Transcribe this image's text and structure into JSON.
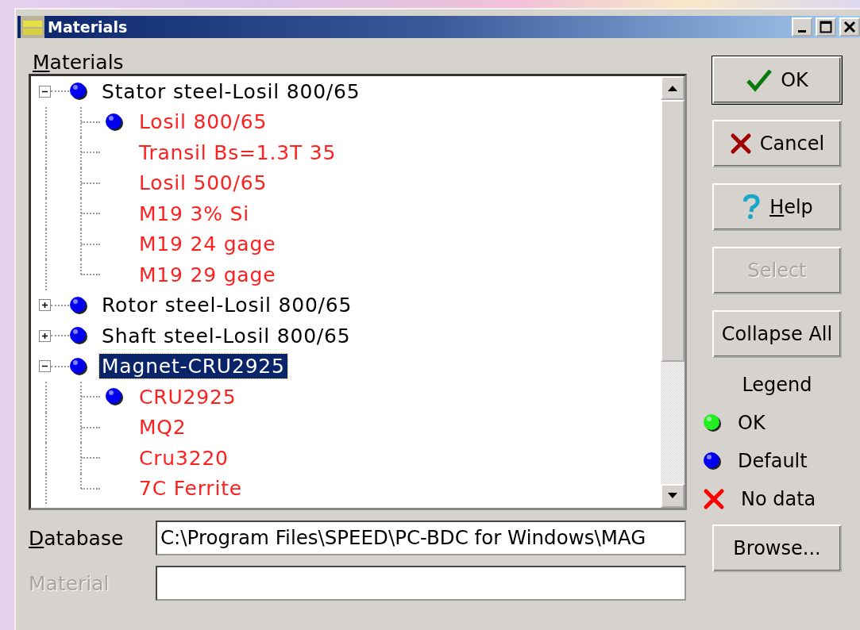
{
  "window": {
    "title": "Materials"
  },
  "materials_label": {
    "text": "Materials",
    "underline_first": true
  },
  "tree": [
    {
      "label": "Stator steel-Losil 800/65",
      "kind": "group",
      "dot": true,
      "expanded": true,
      "selected": false,
      "children": [
        {
          "label": "Losil 800/65",
          "kind": "material",
          "dot": true,
          "selected": false
        },
        {
          "label": "Transil Bs=1.3T  35",
          "kind": "material",
          "dot": false,
          "selected": false
        },
        {
          "label": "Losil 500/65",
          "kind": "material",
          "dot": false,
          "selected": false
        },
        {
          "label": "M19 3% Si",
          "kind": "material",
          "dot": false,
          "selected": false
        },
        {
          "label": "M19 24 gage",
          "kind": "material",
          "dot": false,
          "selected": false
        },
        {
          "label": "M19 29 gage",
          "kind": "material",
          "dot": false,
          "selected": false
        }
      ]
    },
    {
      "label": "Rotor steel-Losil 800/65",
      "kind": "group",
      "dot": true,
      "expanded": false,
      "selected": false
    },
    {
      "label": "Shaft steel-Losil 800/65",
      "kind": "group",
      "dot": true,
      "expanded": false,
      "selected": false
    },
    {
      "label": "Magnet-CRU2925",
      "kind": "group",
      "dot": true,
      "expanded": true,
      "selected": true,
      "children": [
        {
          "label": "CRU2925",
          "kind": "material",
          "dot": true,
          "selected": false
        },
        {
          "label": "MQ2",
          "kind": "material",
          "dot": false,
          "selected": false
        },
        {
          "label": "Cru3220",
          "kind": "material",
          "dot": false,
          "selected": false
        },
        {
          "label": "7C Ferrite",
          "kind": "material",
          "dot": false,
          "selected": false
        }
      ]
    }
  ],
  "buttons": [
    {
      "label": "OK",
      "kind": "check",
      "default": true,
      "disabled": false,
      "underline_first": false
    },
    {
      "label": "Cancel",
      "kind": "cross",
      "default": false,
      "disabled": false,
      "underline_first": false
    },
    {
      "label": "Help",
      "kind": "help",
      "default": false,
      "disabled": false,
      "underline_first": true
    },
    {
      "label": "Select",
      "kind": "plain",
      "default": false,
      "disabled": true,
      "underline_first": false
    },
    {
      "label": "Collapse All",
      "kind": "plain",
      "default": false,
      "disabled": false,
      "underline_first": false
    }
  ],
  "legend": {
    "title": "Legend",
    "items": [
      {
        "label": "OK",
        "kind": "ok"
      },
      {
        "label": "Default",
        "kind": "default"
      },
      {
        "label": "No data",
        "kind": "no_data"
      }
    ]
  },
  "browse_button": {
    "label": "Browse..."
  },
  "database": {
    "label": "Database",
    "underline_first": true,
    "value": "C:\\Program Files\\SPEED\\PC-BDC for Windows\\MAG",
    "disabled": false
  },
  "material": {
    "label": "Material",
    "underline_first": false,
    "disabled": true
  }
}
